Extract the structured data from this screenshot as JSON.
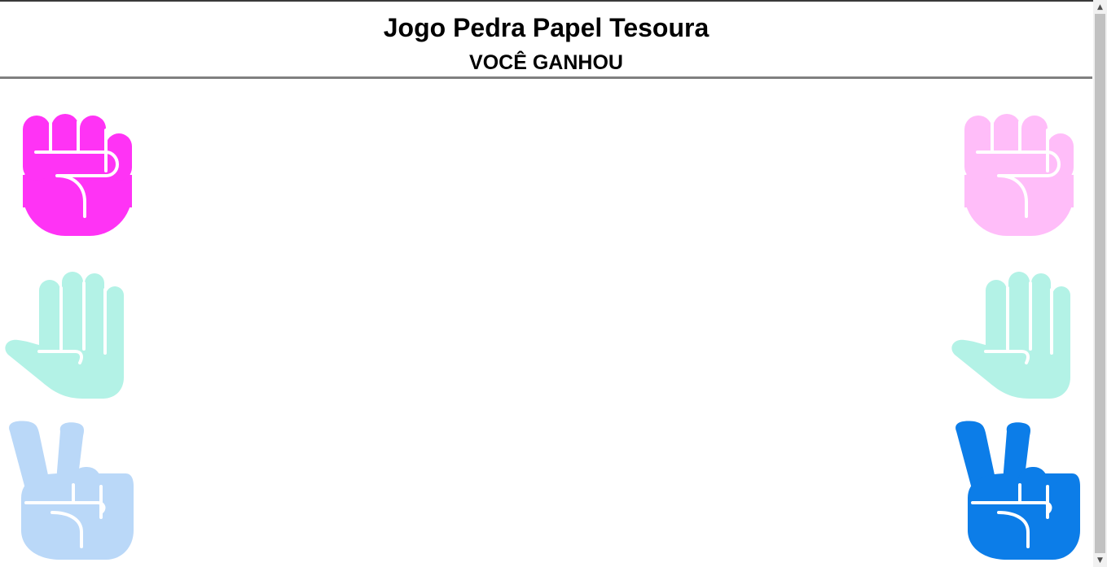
{
  "header": {
    "title": "Jogo Pedra Papel Tesoura",
    "result": "VOCÊ GANHOU"
  },
  "colors": {
    "rock_active": "#ff33f5",
    "rock_faded": "#ffbdf9",
    "paper": "#b3f2e6",
    "scissors_active": "#0c7de8",
    "scissors_faded": "#bad8f8"
  },
  "player": {
    "selected": "rock",
    "choices": [
      "rock",
      "paper",
      "scissors"
    ]
  },
  "computer": {
    "selected": "scissors",
    "choices": [
      "rock",
      "paper",
      "scissors"
    ]
  }
}
